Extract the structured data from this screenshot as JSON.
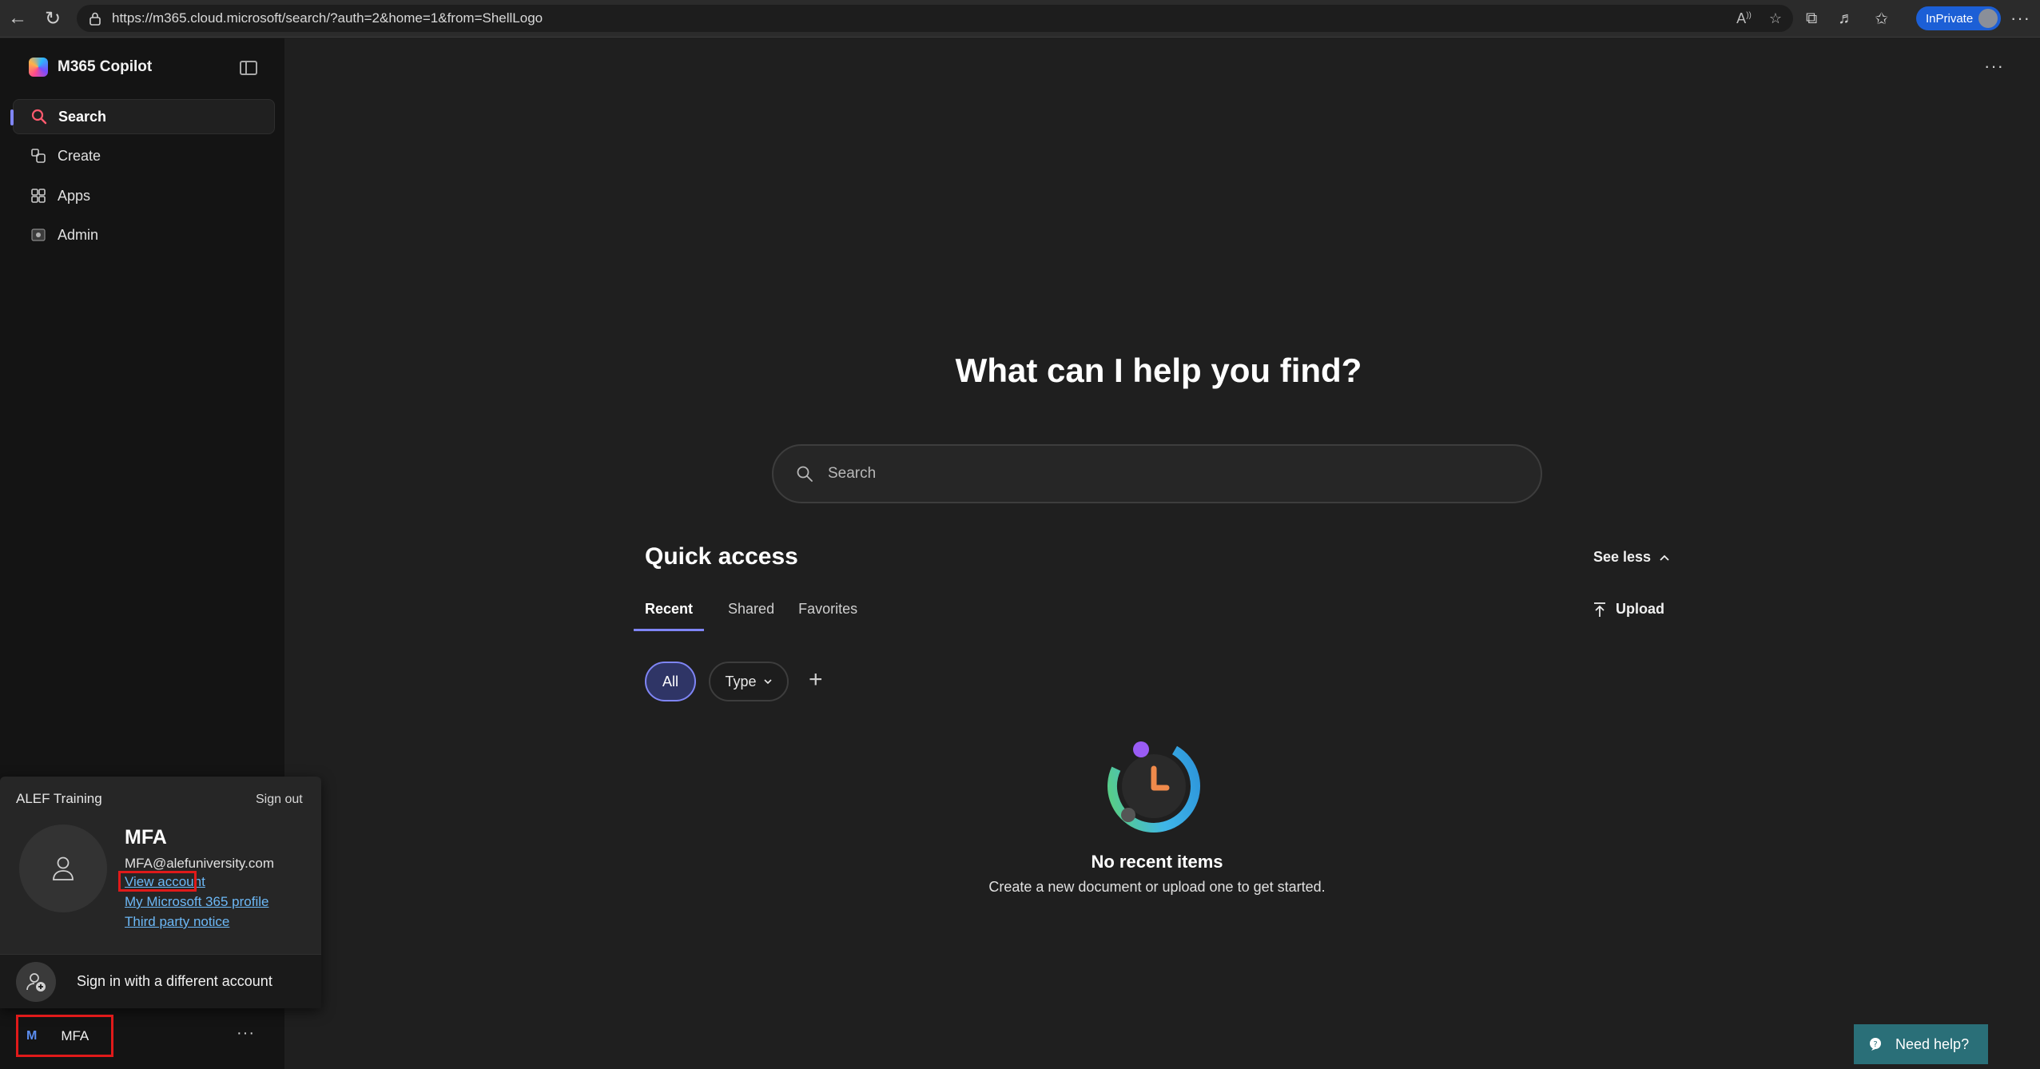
{
  "browser": {
    "url": "https://m365.cloud.microsoft/search/?auth=2&home=1&from=ShellLogo",
    "inprivate_label": "InPrivate"
  },
  "sidebar": {
    "app_name": "M365 Copilot",
    "items": [
      {
        "label": "Search",
        "icon": "search-icon",
        "active": true
      },
      {
        "label": "Create",
        "icon": "create-icon",
        "active": false
      },
      {
        "label": "Apps",
        "icon": "apps-icon",
        "active": false
      },
      {
        "label": "Admin",
        "icon": "admin-icon",
        "active": false
      }
    ]
  },
  "account_flyout": {
    "org": "ALEF Training",
    "sign_out": "Sign out",
    "display_name": "MFA",
    "email": "MFA@alefuniversity.com",
    "links": [
      "View account",
      "My Microsoft 365 profile",
      "Third party notice"
    ],
    "other_account": "Sign in with a different account"
  },
  "profile_bar": {
    "initial": "M",
    "name": "MFA"
  },
  "main": {
    "heading": "What can I help you find?",
    "search_placeholder": "Search",
    "quick_access_title": "Quick access",
    "see_less": "See less",
    "tabs": [
      "Recent",
      "Shared",
      "Favorites"
    ],
    "active_tab": "Recent",
    "upload": "Upload",
    "filters": {
      "all": "All",
      "type": "Type"
    },
    "empty_title": "No recent items",
    "empty_subtitle": "Create a new document or upload one to get started."
  },
  "help": {
    "label": "Need help?"
  },
  "colors": {
    "accent": "#7f85f5",
    "highlight_box": "#e01a1a",
    "link": "#6cb8f6",
    "help_button": "#2a6f78"
  }
}
